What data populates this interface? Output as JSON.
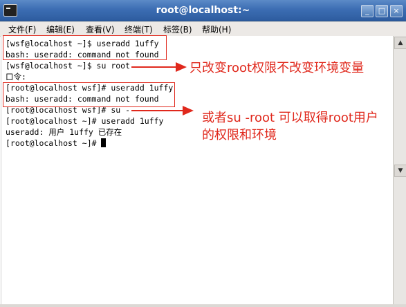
{
  "window": {
    "title": "root@localhost:~",
    "minimize_glyph": "_",
    "maximize_glyph": "□",
    "close_glyph": "×"
  },
  "menu": [
    {
      "label": "文件(F)"
    },
    {
      "label": "编辑(E)"
    },
    {
      "label": "查看(V)"
    },
    {
      "label": "终端(T)"
    },
    {
      "label": "标签(B)"
    },
    {
      "label": "帮助(H)"
    }
  ],
  "terminal": {
    "lines": [
      "[wsf@localhost ~]$ useradd 1uffy",
      "bash: useradd: command not found",
      "[wsf@localhost ~]$ su root",
      "口令:",
      "[root@localhost wsf]# useradd 1uffy",
      "bash: useradd: command not found",
      "[root@localhost wsf]# su -",
      "[root@localhost ~]# useradd 1uffy",
      "useradd: 用户 1uffy 已存在",
      "[root@localhost ~]# "
    ]
  },
  "annotations": {
    "note1": "只改变root权限不改变环境变量",
    "note2_line1": "或者su -root 可以取得root用户",
    "note2_line2": "的权限和环境",
    "color": "#e0281c"
  },
  "icons": {
    "app": "terminal-icon",
    "scroll_up": "arrow-up-icon",
    "scroll_down": "arrow-down-icon"
  }
}
